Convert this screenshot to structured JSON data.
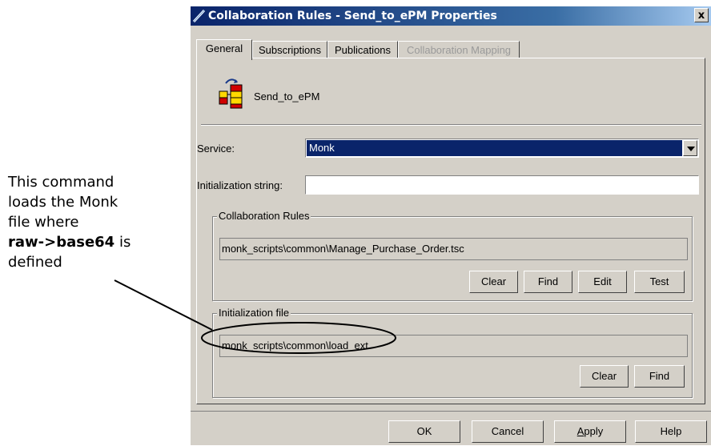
{
  "callout": {
    "line1": "This command",
    "line2": "loads the Monk",
    "line3": "file where",
    "bold_text": "raw->base64",
    "line4_suffix": " is",
    "line5": "defined"
  },
  "dialog": {
    "title": "Collaboration Rules - Send_to_ePM Properties",
    "close_symbol": "x",
    "tabs": [
      {
        "label": "General",
        "active": true,
        "enabled": true
      },
      {
        "label": "Subscriptions",
        "active": false,
        "enabled": true
      },
      {
        "label": "Publications",
        "active": false,
        "enabled": true
      },
      {
        "label": "Collaboration Mapping",
        "active": false,
        "enabled": false
      }
    ],
    "collaboration_name": "Send_to_ePM",
    "service": {
      "label": "Service:",
      "value": "Monk"
    },
    "init_string": {
      "label": "Initialization string:",
      "value": ""
    },
    "collab_rules_group": {
      "title": "Collaboration Rules",
      "path": "monk_scripts\\common\\Manage_Purchase_Order.tsc",
      "buttons": [
        "Clear",
        "Find",
        "Edit",
        "Test"
      ]
    },
    "init_file_group": {
      "title": "Initialization file",
      "path": "monk_scripts\\common\\load_ext",
      "buttons": [
        "Clear",
        "Find"
      ]
    },
    "footer_buttons": {
      "ok": "OK",
      "cancel": "Cancel",
      "apply_prefix": "",
      "apply_underlined": "A",
      "apply_rest": "pply",
      "help": "Help"
    }
  },
  "colors": {
    "title_gradient_start": "#0a246a",
    "dialog_bg": "#d4d0c8",
    "selection_bg": "#0a246a"
  }
}
